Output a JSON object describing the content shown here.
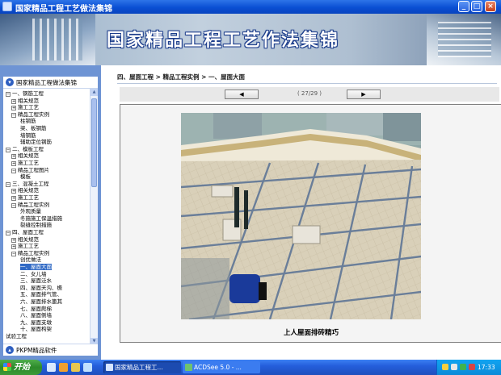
{
  "window": {
    "title": "国家精品工程工艺做法集锦",
    "minimize": "_",
    "maximize": "□",
    "close": "×"
  },
  "banner": {
    "title": "国家精品工程工艺作法集锦"
  },
  "sidebar": {
    "header_label": "国家精品工程做法集锦",
    "footer_label": "PKPM精品软件",
    "tree": [
      {
        "label": "一、钢筋工程",
        "exp": "−",
        "indent": 0
      },
      {
        "label": "相关规范",
        "exp": "+",
        "indent": 1
      },
      {
        "label": "施工工艺",
        "exp": "+",
        "indent": 1
      },
      {
        "label": "精品工程实例",
        "exp": "−",
        "indent": 1
      },
      {
        "label": "柱钢筋",
        "exp": "",
        "indent": 2
      },
      {
        "label": "梁、板钢筋",
        "exp": "",
        "indent": 2
      },
      {
        "label": "墙钢筋",
        "exp": "",
        "indent": 2
      },
      {
        "label": "辅助定位钢筋",
        "exp": "",
        "indent": 2
      },
      {
        "label": "二、模板工程",
        "exp": "−",
        "indent": 0
      },
      {
        "label": "相关规范",
        "exp": "+",
        "indent": 1
      },
      {
        "label": "施工工艺",
        "exp": "+",
        "indent": 1
      },
      {
        "label": "精品工程图片",
        "exp": "−",
        "indent": 1
      },
      {
        "label": "模板",
        "exp": "",
        "indent": 2
      },
      {
        "label": "三、混凝土工程",
        "exp": "−",
        "indent": 0
      },
      {
        "label": "相关规范",
        "exp": "+",
        "indent": 1
      },
      {
        "label": "施工工艺",
        "exp": "+",
        "indent": 1
      },
      {
        "label": "精品工程实例",
        "exp": "−",
        "indent": 1
      },
      {
        "label": "外观质量",
        "exp": "",
        "indent": 2
      },
      {
        "label": "冬施施工保温措施",
        "exp": "",
        "indent": 2
      },
      {
        "label": "裂缝控制措施",
        "exp": "",
        "indent": 2
      },
      {
        "label": "四、屋面工程",
        "exp": "−",
        "indent": 0
      },
      {
        "label": "相关规范",
        "exp": "+",
        "indent": 1
      },
      {
        "label": "施工工艺",
        "exp": "+",
        "indent": 1
      },
      {
        "label": "精品工程实例",
        "exp": "−",
        "indent": 1
      },
      {
        "label": "创优做法",
        "exp": "",
        "indent": 2
      },
      {
        "label": "一、屋面大面",
        "exp": "",
        "indent": 2,
        "selected": true
      },
      {
        "label": "二、女儿墙",
        "exp": "",
        "indent": 2
      },
      {
        "label": "三、屋面泛水",
        "exp": "",
        "indent": 2
      },
      {
        "label": "四、屋面天沟、檐",
        "exp": "",
        "indent": 2
      },
      {
        "label": "五、屋面排气管、",
        "exp": "",
        "indent": 2
      },
      {
        "label": "六、屋面排水篦其",
        "exp": "",
        "indent": 2
      },
      {
        "label": "七、屋面爬梯",
        "exp": "",
        "indent": 2
      },
      {
        "label": "八、屋面侧墙",
        "exp": "",
        "indent": 2
      },
      {
        "label": "九、屋面支墩",
        "exp": "",
        "indent": 2
      },
      {
        "label": "十、屋面构架",
        "exp": "",
        "indent": 2
      },
      {
        "label": "试验工程",
        "exp": "",
        "indent": 0
      }
    ]
  },
  "main": {
    "breadcrumb": "四、屋面工程 > 精品工程实例 > 一、屋面大面",
    "prev_glyph": "◀",
    "next_glyph": "▶",
    "page_index": "( 27/29 )",
    "caption": "上人屋面排砖精巧"
  },
  "taskbar": {
    "start": "开始",
    "tasks": [
      "国家精品工程工...",
      "ACDSee 5.0 - ..."
    ],
    "clock": "17:33"
  },
  "colors": {
    "titlebar": "#0a4fd3",
    "sidebar": "#6e94d4",
    "selection": "#316ac5",
    "taskbar": "#245edb",
    "start": "#2d8a2b"
  }
}
